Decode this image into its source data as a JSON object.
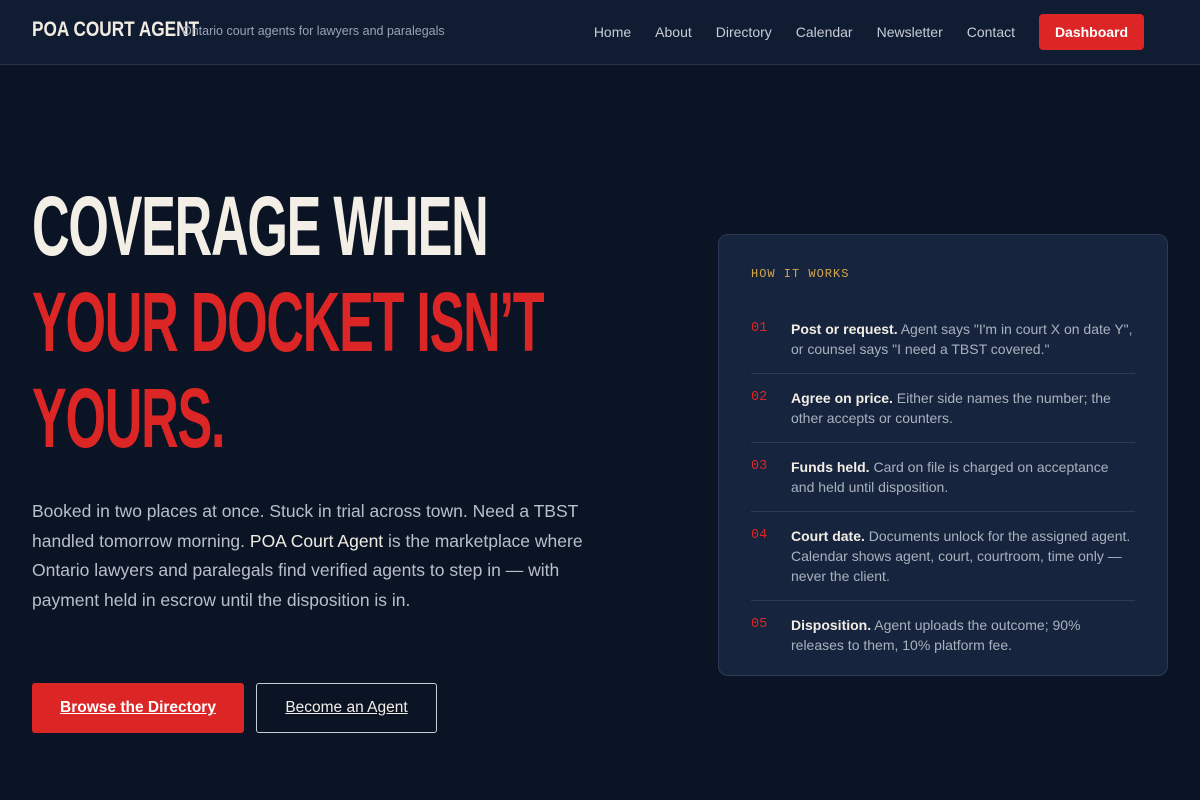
{
  "header": {
    "brand": "POA COURT AGENT",
    "tagline": "Ontario court agents for lawyers and paralegals",
    "nav": [
      "Home",
      "About",
      "Directory",
      "Calendar",
      "Newsletter",
      "Contact"
    ],
    "dashboard_label": "Dashboard"
  },
  "hero": {
    "title_line1": "COVERAGE WHEN",
    "title_line2": "YOUR DOCKET ISN’T",
    "title_line3": "YOURS.",
    "desc_before": "Booked in two places at once. Stuck in trial across town. Need a TBST handled tomorrow morning. ",
    "desc_highlight": "POA Court Agent",
    "desc_after": " is the marketplace where Ontario lawyers and paralegals find verified agents to step in — with payment held in escrow until the disposition is in.",
    "primary_button": "Browse the Directory",
    "secondary_button": "Become an Agent"
  },
  "how_it_works": {
    "heading": "HOW IT WORKS",
    "steps": [
      {
        "num": "01",
        "title": "Post or request.",
        "text": " Agent says \"I'm in court X on date Y\", or counsel says \"I need a TBST covered.\""
      },
      {
        "num": "02",
        "title": "Agree on price.",
        "text": " Either side names the number; the other accepts or counters."
      },
      {
        "num": "03",
        "title": "Funds held.",
        "text": " Card on file is charged on acceptance and held until disposition."
      },
      {
        "num": "04",
        "title": "Court date.",
        "text": " Documents unlock for the assigned agent. Calendar shows agent, court, courtroom, time only — never the client."
      },
      {
        "num": "05",
        "title": "Disposition.",
        "text": " Agent uploads the outcome; 90% releases to them, 10% platform fee."
      }
    ]
  },
  "colors": {
    "background": "#0b1425",
    "accent": "#dc2626",
    "card": "#16243d",
    "label": "#d6a64a"
  }
}
